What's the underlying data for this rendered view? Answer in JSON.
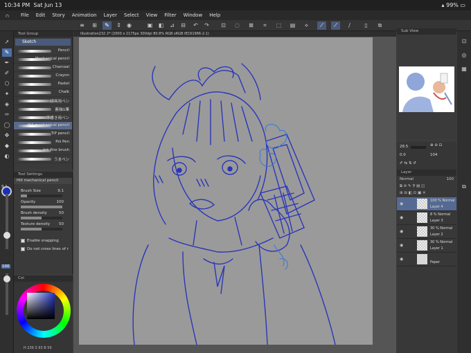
{
  "status": {
    "time": "10:34 PM",
    "date": "Sat Jun 13",
    "battery": "99%"
  },
  "menu": {
    "items": [
      "File",
      "Edit",
      "Story",
      "Animation",
      "Layer",
      "Select",
      "View",
      "Filter",
      "Window",
      "Help"
    ]
  },
  "document": {
    "tab": "Illustration232 2* (2000 x 2175px 300dpi 80.8%  RGB sRGB IEC61966-2.1)"
  },
  "subtool": {
    "panel_title": "Tool Group",
    "group": "Sketch",
    "brushes": [
      "Pencil",
      "Mechanical pencil",
      "Charcoal",
      "Crayon",
      "Pastel",
      "Chalk",
      "線画用ペン",
      "素描G筆",
      "下書き用ペン",
      "Hill mechanical pencil",
      "TiP pencil",
      "Poi Pen",
      "Ink fine brush",
      "うまペン"
    ],
    "selected_index": 9
  },
  "toolprop": {
    "panel_title": "Tool Settings",
    "current": "Hill mechanical pencil",
    "brush_size": {
      "label": "Brush Size",
      "value": "9.1",
      "fraction": 0.15
    },
    "opacity": {
      "label": "Opacity",
      "value": "100",
      "fraction": 1.0
    },
    "density": {
      "label": "Brush density",
      "value": "50",
      "fraction": 0.5
    },
    "texture": {
      "label": "Texture density",
      "value": "50",
      "fraction": 0.5
    },
    "enable_snapping": "Enable snapping",
    "no_cross": "Do not cross lines of reference layer"
  },
  "left_size": {
    "size": "9.1",
    "opacity": "100"
  },
  "color": {
    "panel_title": "Col",
    "info": "H 236  S 93  B 59",
    "main_color": "#1a2fc0"
  },
  "subview": {
    "title": "Sub View"
  },
  "nav": {
    "zoom": "28.5",
    "rotate": "0.0",
    "angle": "104"
  },
  "layers": {
    "panel_title": "Layer",
    "blend": "Normal",
    "opacity": "100",
    "items": [
      {
        "opacity": "100 %  Normal",
        "name": "Layer 4",
        "selected": true
      },
      {
        "opacity": "8 %  Normal",
        "name": "Layer 3",
        "selected": false
      },
      {
        "opacity": "30 %  Normal",
        "name": "Layer 2",
        "selected": false
      },
      {
        "opacity": "30 %  Normal",
        "name": "Layer 1",
        "selected": false
      },
      {
        "opacity": "",
        "name": "Paper",
        "selected": false
      }
    ]
  },
  "colors": {
    "stroke": "#2a36b8",
    "accent": "#4d6fa8",
    "paper": "#9a9a9a"
  }
}
